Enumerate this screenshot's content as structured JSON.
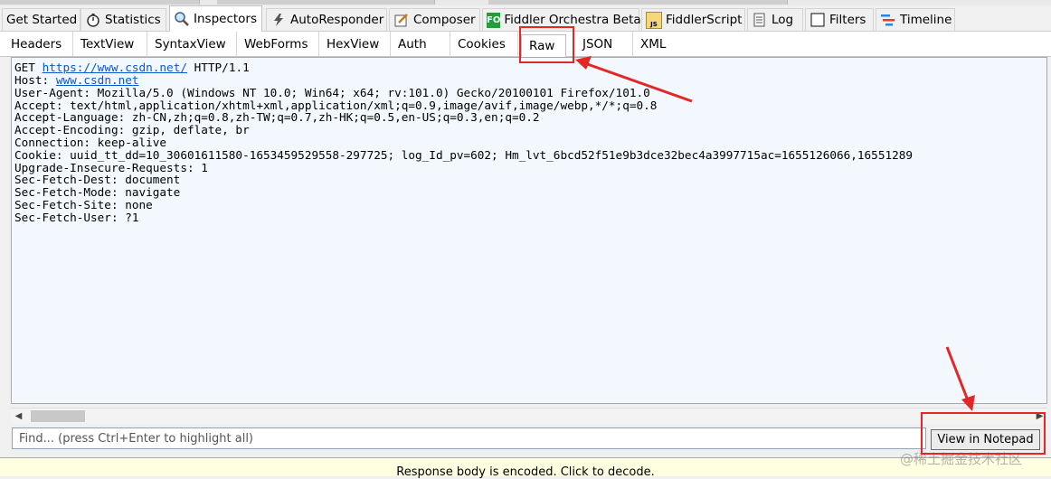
{
  "main_tabs": [
    {
      "label": "Get Started",
      "icon": "none"
    },
    {
      "label": "Statistics",
      "icon": "stopwatch-icon"
    },
    {
      "label": "Inspectors",
      "icon": "magnifier-icon"
    },
    {
      "label": "AutoResponder",
      "icon": "lightning-icon"
    },
    {
      "label": "Composer",
      "icon": "pencil-icon"
    },
    {
      "label": "Fiddler Orchestra Beta",
      "icon": "fo-icon",
      "icon_text": "FO"
    },
    {
      "label": "FiddlerScript",
      "icon": "script-icon",
      "icon_text": "JS"
    },
    {
      "label": "Log",
      "icon": "log-icon"
    },
    {
      "label": "Filters",
      "icon": "checkbox-icon"
    },
    {
      "label": "Timeline",
      "icon": "timeline-icon"
    }
  ],
  "sub_tabs": [
    "Headers",
    "TextView",
    "SyntaxView",
    "WebForms",
    "HexView",
    "Auth",
    "Cookies",
    "Raw",
    "JSON",
    "XML"
  ],
  "request": {
    "first_line_method": "GET",
    "first_line_url": "https://www.csdn.net/",
    "first_line_proto": "HTTP/1.1",
    "host_label": "Host:",
    "host_value": "www.csdn.net",
    "lines": [
      "User-Agent: Mozilla/5.0 (Windows NT 10.0; Win64; x64; rv:101.0) Gecko/20100101 Firefox/101.0",
      "Accept: text/html,application/xhtml+xml,application/xml;q=0.9,image/avif,image/webp,*/*;q=0.8",
      "Accept-Language: zh-CN,zh;q=0.8,zh-TW;q=0.7,zh-HK;q=0.5,en-US;q=0.3,en;q=0.2",
      "Accept-Encoding: gzip, deflate, br",
      "Connection: keep-alive",
      "Cookie: uuid_tt_dd=10_30601611580-1653459529558-297725; log_Id_pv=602; Hm_lvt_6bcd52f51e9b3dce32bec4a3997715ac=1655126066,16551289",
      "Upgrade-Insecure-Requests: 1",
      "Sec-Fetch-Dest: document",
      "Sec-Fetch-Mode: navigate",
      "Sec-Fetch-Site: none",
      "Sec-Fetch-User: ?1"
    ]
  },
  "find": {
    "placeholder": "Find... (press Ctrl+Enter to highlight all)"
  },
  "view_button": "View in Notepad",
  "status_bar": "Response body is encoded. Click to decode.",
  "watermark": "@稀土掘金技术社区",
  "colors": {
    "annotation_red": "#e52626",
    "link": "#0b57d0"
  }
}
